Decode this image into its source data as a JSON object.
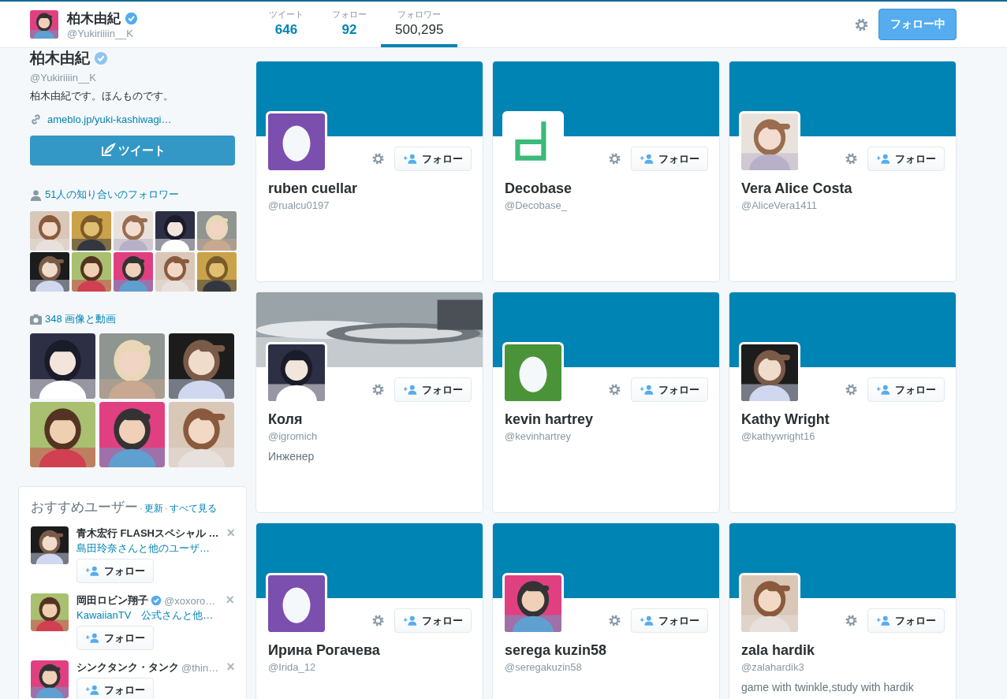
{
  "header": {
    "name": "柏木由紀",
    "verified": true,
    "handle": "@Yukiriiiin__K",
    "stats": [
      {
        "label": "ツイート",
        "value": "646",
        "selected": false
      },
      {
        "label": "フォロー",
        "value": "92",
        "selected": false
      },
      {
        "label": "フォロワー",
        "value": "500,295",
        "selected": true
      }
    ],
    "following_button": "フォロー中"
  },
  "profile": {
    "name": "柏木由紀",
    "verified": true,
    "handle": "@Yukiriiiin__K",
    "bio": "柏木由紀です。ほんものです。",
    "link": "ameblo.jp/yuki-kashiwagi…",
    "tweet_button": "ツイート"
  },
  "followers_you_know": {
    "label": "51人の知り合いのフォロワー"
  },
  "media": {
    "label": "348 画像と動画"
  },
  "suggestions": {
    "title": "おすすめユーザー",
    "separator": "·",
    "refresh": "更新",
    "separator_2": "·",
    "view_all": "すべて見る",
    "users": [
      {
        "name": "青木宏行 FLASHスペシャル …",
        "verified": false,
        "context": "島田玲奈さんと他のユーザ…",
        "follow": "フォロー",
        "close": "×"
      },
      {
        "name": "岡田ロビン翔子",
        "verified": true,
        "handle": "@xoxoro…",
        "context": "KawaiianTV　公式さんと他…",
        "follow": "フォロー",
        "close": "×"
      },
      {
        "name": "シンクタンク・タンク",
        "verified": false,
        "handle": "@thin…",
        "follow": "フォロー",
        "close": "×"
      }
    ]
  },
  "cards": [
    {
      "banner": {
        "kind": "plain"
      },
      "avatar": {
        "kind": "egg",
        "color": "#7b4fae"
      },
      "name": "ruben cuellar",
      "handle": "@rualcu0197",
      "follow": "フォロー"
    },
    {
      "banner": {
        "kind": "plain"
      },
      "avatar": {
        "kind": "logo",
        "color": "#3cba7a"
      },
      "name": "Decobase",
      "handle": "@Decobase_",
      "follow": "フォロー"
    },
    {
      "banner": {
        "kind": "plain"
      },
      "name": "Vera Alice Costa",
      "handle": "@AliceVera1411",
      "follow": "フォロー"
    },
    {
      "name": "Коля",
      "handle": "@igromich",
      "bio": "Инженер",
      "follow": "フォロー"
    },
    {
      "banner": {
        "kind": "plain"
      },
      "avatar": {
        "kind": "egg",
        "color": "#4a9339"
      },
      "name": "kevin hartrey",
      "handle": "@kevinhartrey",
      "follow": "フォロー"
    },
    {
      "banner": {
        "kind": "plain"
      },
      "name": "Kathy Wright",
      "handle": "@kathywright16",
      "follow": "フォロー"
    },
    {
      "banner": {
        "kind": "plain"
      },
      "avatar": {
        "kind": "egg",
        "color": "#7b4fae"
      },
      "name": "Ирина Рогачева",
      "handle": "@Irida_12",
      "follow": "フォロー"
    },
    {
      "banner": {
        "kind": "plain"
      },
      "name": "serega kuzin58",
      "handle": "@seregakuzin58",
      "follow": "フォロー"
    },
    {
      "banner": {
        "kind": "plain"
      },
      "name": "zala hardik",
      "handle": "@zalahardik3",
      "bio": "game with twinkle,study with hardik",
      "follow": "フォロー"
    }
  ]
}
